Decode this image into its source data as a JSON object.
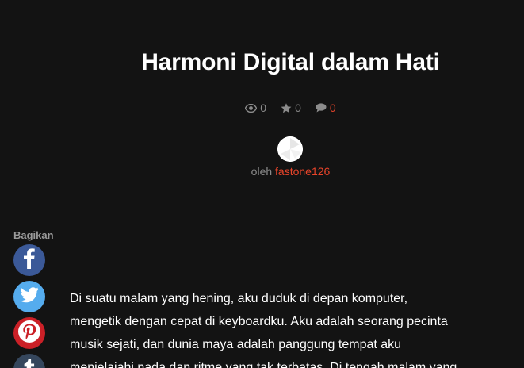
{
  "article": {
    "title": "Harmoni Digital dalam Hati",
    "views": "0",
    "rating": "0",
    "comments": "0",
    "by_prefix": "oleh",
    "author": "fastone126",
    "body_line_1": "Di suatu malam yang hening, aku duduk di depan komputer,",
    "body_line_2": "mengetik dengan cepat di keyboardku. Aku adalah seorang pecinta",
    "body_line_3": "musik sejati, dan dunia maya adalah panggung tempat aku",
    "body_line_4": "menjelajahi nada dan ritme yang tak terbatas. Di tengah malam yang"
  },
  "share": {
    "label": "Bagikan",
    "buttons": [
      {
        "network": "facebook",
        "icon": "facebook-icon",
        "color": "#3b5998"
      },
      {
        "network": "twitter",
        "icon": "twitter-icon",
        "color": "#55acee"
      },
      {
        "network": "pinterest",
        "icon": "pinterest-icon",
        "color": "#cb2027"
      },
      {
        "network": "tumblr",
        "icon": "tumblr-icon",
        "color": "#35465c"
      }
    ]
  },
  "colors": {
    "background": "#131313",
    "accent": "#e8442a",
    "muted": "#8c8c8c"
  }
}
